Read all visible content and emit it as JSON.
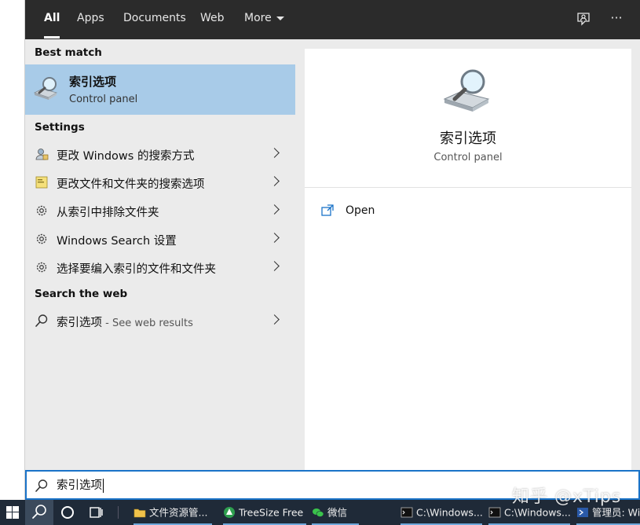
{
  "tabs": [
    {
      "label": "All",
      "active": true
    },
    {
      "label": "Apps"
    },
    {
      "label": "Documents"
    },
    {
      "label": "Web"
    },
    {
      "label": "More"
    }
  ],
  "toolbar": {
    "feedback_icon": "feedback-icon",
    "more_icon": "ellipsis-icon",
    "more_glyph": "···"
  },
  "results": {
    "best_match_header": "Best match",
    "best_match": {
      "title": "索引选项",
      "subtitle": "Control panel",
      "icon": "indexing-options-icon"
    },
    "settings_header": "Settings",
    "settings": [
      {
        "label": "更改 Windows 的搜索方式",
        "icon": "search-permissions-icon"
      },
      {
        "label": "更改文件和文件夹的搜索选项",
        "icon": "folder-options-icon"
      },
      {
        "label": "从索引中排除文件夹",
        "icon": "gear-icon"
      },
      {
        "label": "Windows Search 设置",
        "icon": "gear-icon"
      },
      {
        "label": "选择要编入索引的文件和文件夹",
        "icon": "gear-icon"
      }
    ],
    "web_header": "Search the web",
    "web": {
      "label": "索引选项",
      "suffix": " - See web results",
      "icon": "search-icon"
    }
  },
  "preview": {
    "title": "索引选项",
    "subtitle": "Control panel",
    "open_label": "Open"
  },
  "search": {
    "value": "索引选项"
  },
  "taskbar": {
    "apps": [
      {
        "label": "文件资源管...",
        "icon": "folder-icon"
      },
      {
        "label": "TreeSize Free",
        "icon": "treesize-icon"
      },
      {
        "label": "微信",
        "icon": "wechat-icon"
      },
      {
        "label": "C:\\Windows...",
        "icon": "cmd-icon"
      },
      {
        "label": "C:\\Windows...",
        "icon": "cmd-icon"
      },
      {
        "label": "管理员: Wi",
        "icon": "powershell-icon"
      }
    ]
  },
  "watermark": "知乎 @xTips",
  "colors": {
    "accent": "#1a73c8",
    "selected": "#a8cbe8",
    "tabbar": "#2b2b2b",
    "taskbar": "#1f2a38"
  }
}
